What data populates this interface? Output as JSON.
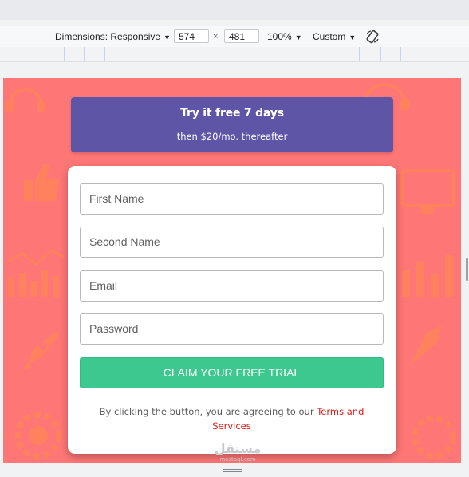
{
  "devtools": {
    "dimensions_label": "Dimensions: Responsive",
    "width_value": "574",
    "times_sign": "×",
    "height_value": "481",
    "zoom": "100%",
    "throttle": "Custom"
  },
  "banner": {
    "title": "Try it free 7 days",
    "subtitle": "then $20/mo. thereafter",
    "color": "#5e55a6"
  },
  "form": {
    "first_name_placeholder": "First Name",
    "second_name_placeholder": "Second Name",
    "email_placeholder": "Email",
    "password_placeholder": "Password",
    "cta_label": "CLAIM YOUR FREE TRIAL",
    "cta_color": "#3cc88e",
    "terms_prefix": "By clicking the button, you are agreeing to our ",
    "terms_link": "Terms and Services"
  },
  "watermark": {
    "arabic": "مستقل",
    "latin": "mostaql.com"
  },
  "colors": {
    "page_background": "#ff7676",
    "link": "#e01b1b"
  }
}
